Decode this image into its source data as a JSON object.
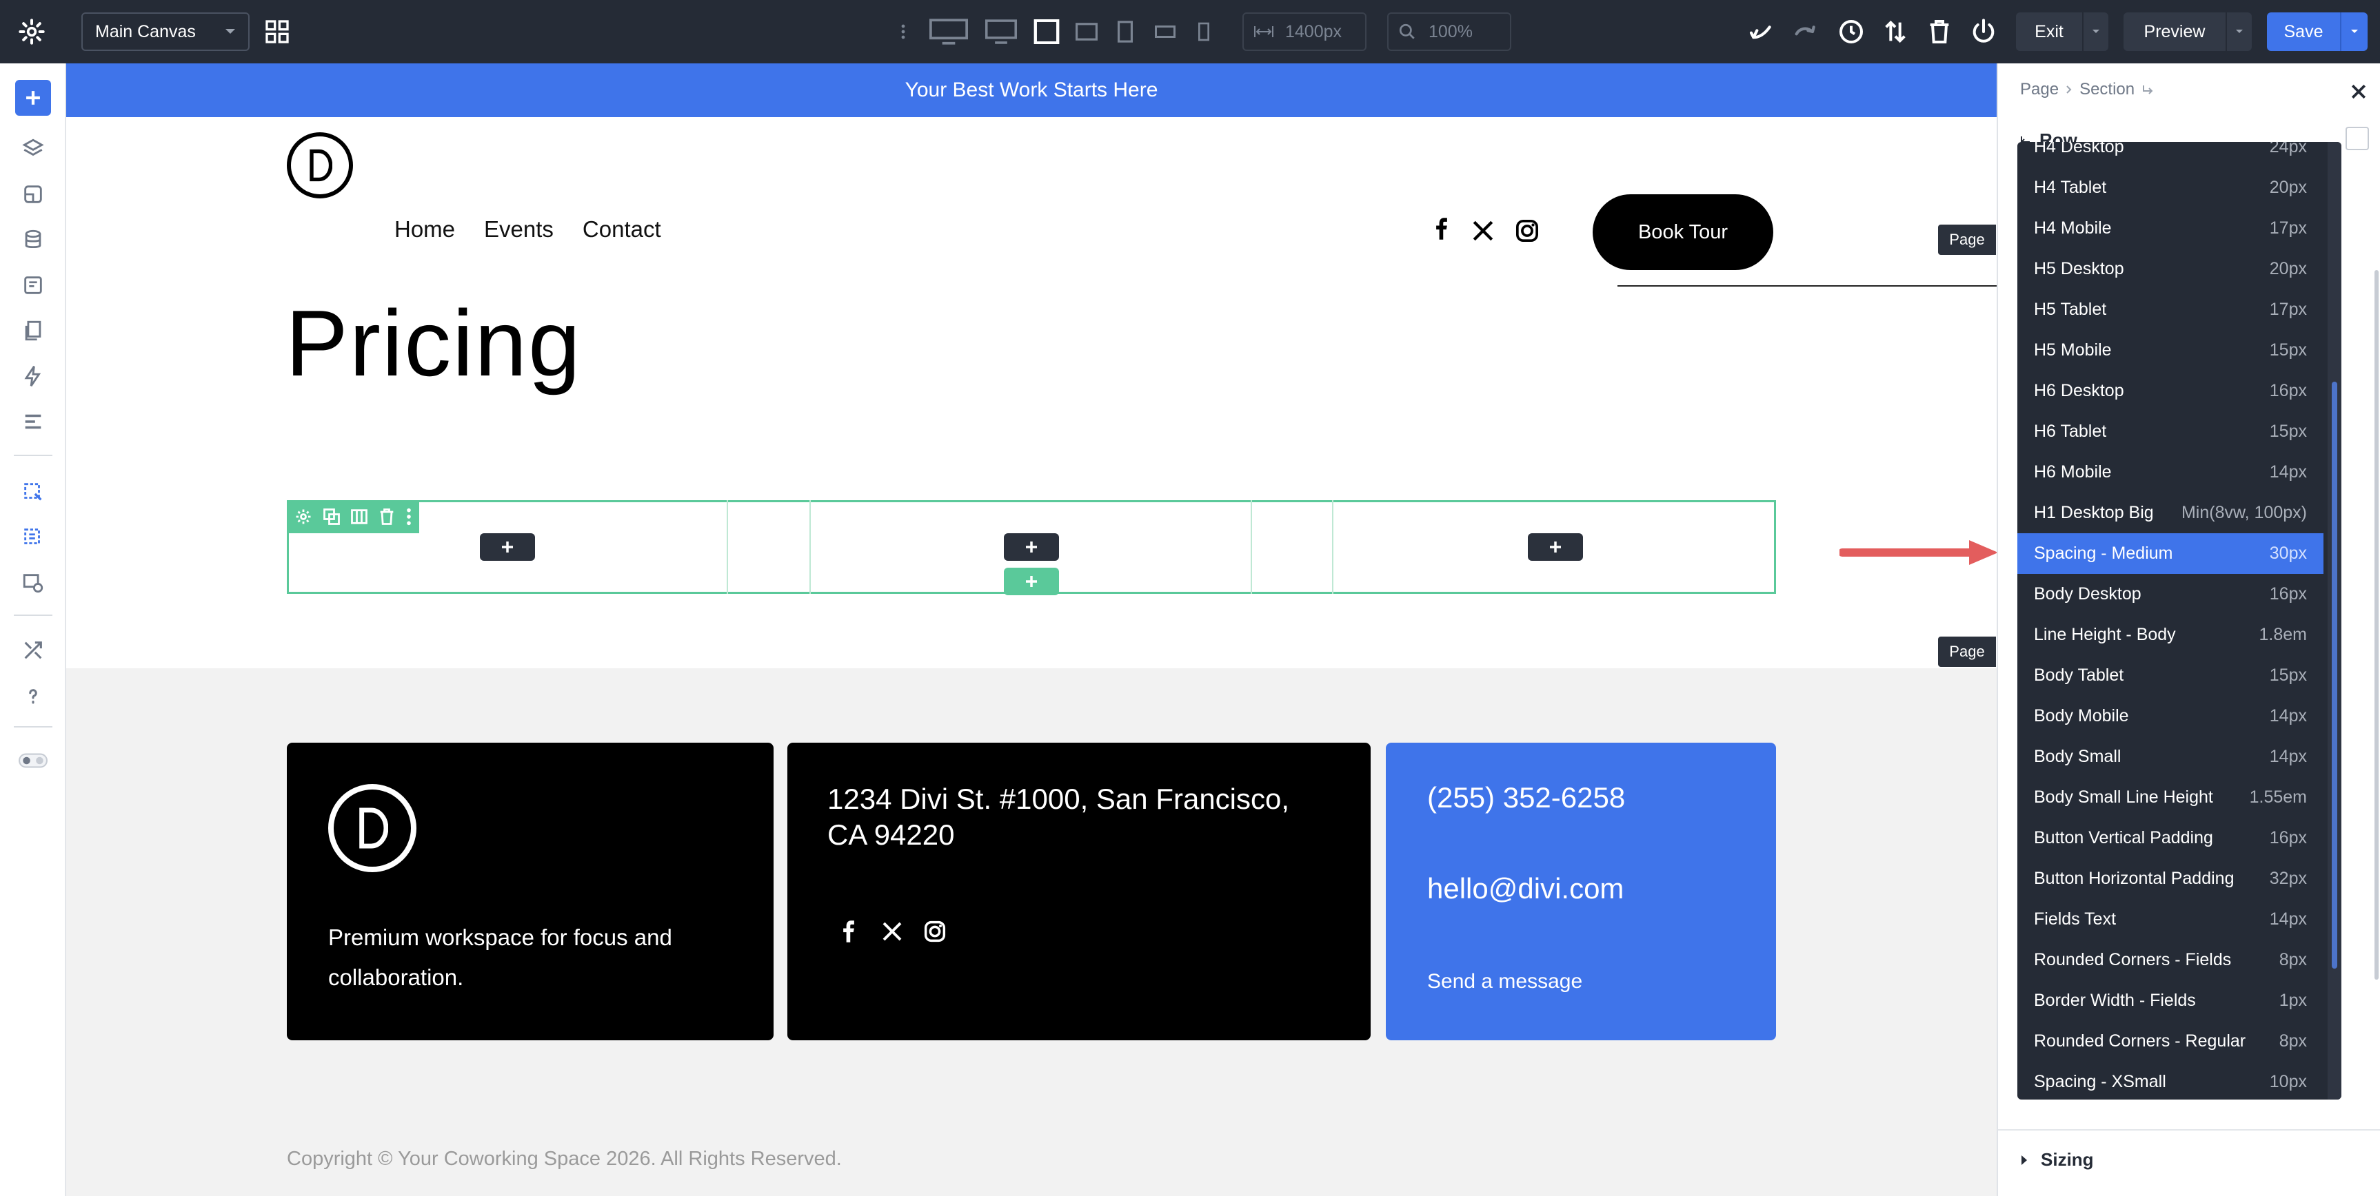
{
  "toolbar": {
    "canvas_select": "Main Canvas",
    "width_value": "1400px",
    "zoom_value": "100%",
    "exit_label": "Exit",
    "preview_label": "Preview",
    "save_label": "Save"
  },
  "site": {
    "banner": "Your Best Work Starts Here",
    "nav": [
      "Home",
      "Events",
      "Contact"
    ],
    "cta": "Book Tour",
    "heading": "Pricing",
    "page_tag_1": "Page",
    "page_tag_2": "Page"
  },
  "footer": {
    "tagline": "Premium workspace for focus and collaboration.",
    "address": "1234 Divi St. #1000, San Francisco, CA 94220",
    "phone": "(255) 352-6258",
    "email": "hello@divi.com",
    "message_link": "Send a message",
    "copyright": "Copyright © Your Coworking Space 2026. All Rights Reserved."
  },
  "panel": {
    "breadcrumb": [
      "Page",
      "Section"
    ],
    "row_label": "Row",
    "sizing_label": "Sizing"
  },
  "dropdown": {
    "items": [
      {
        "name": "H4 Desktop",
        "value": "24px"
      },
      {
        "name": "H4 Tablet",
        "value": "20px"
      },
      {
        "name": "H4 Mobile",
        "value": "17px"
      },
      {
        "name": "H5 Desktop",
        "value": "20px"
      },
      {
        "name": "H5 Tablet",
        "value": "17px"
      },
      {
        "name": "H5 Mobile",
        "value": "15px"
      },
      {
        "name": "H6 Desktop",
        "value": "16px"
      },
      {
        "name": "H6 Tablet",
        "value": "15px"
      },
      {
        "name": "H6 Mobile",
        "value": "14px"
      },
      {
        "name": "H1 Desktop Big",
        "value": "Min(8vw, 100px)"
      },
      {
        "name": "Spacing - Medium",
        "value": "30px"
      },
      {
        "name": "Body Desktop",
        "value": "16px"
      },
      {
        "name": "Line Height - Body",
        "value": "1.8em"
      },
      {
        "name": "Body Tablet",
        "value": "15px"
      },
      {
        "name": "Body Mobile",
        "value": "14px"
      },
      {
        "name": "Body Small",
        "value": "14px"
      },
      {
        "name": "Body Small Line Height",
        "value": "1.55em"
      },
      {
        "name": "Button Vertical Padding",
        "value": "16px"
      },
      {
        "name": "Button Horizontal Padding",
        "value": "32px"
      },
      {
        "name": "Fields Text",
        "value": "14px"
      },
      {
        "name": "Rounded Corners - Fields",
        "value": "8px"
      },
      {
        "name": "Border Width - Fields",
        "value": "1px"
      },
      {
        "name": "Rounded Corners - Regular",
        "value": "8px"
      },
      {
        "name": "Spacing - XSmall",
        "value": "10px"
      }
    ]
  },
  "colors": {
    "topbar": "#252b36",
    "accent": "#3f74ea",
    "row_outline": "#5ac99a",
    "arrow": "#e35d5d",
    "footer_card_blue": "#3f74ea"
  }
}
